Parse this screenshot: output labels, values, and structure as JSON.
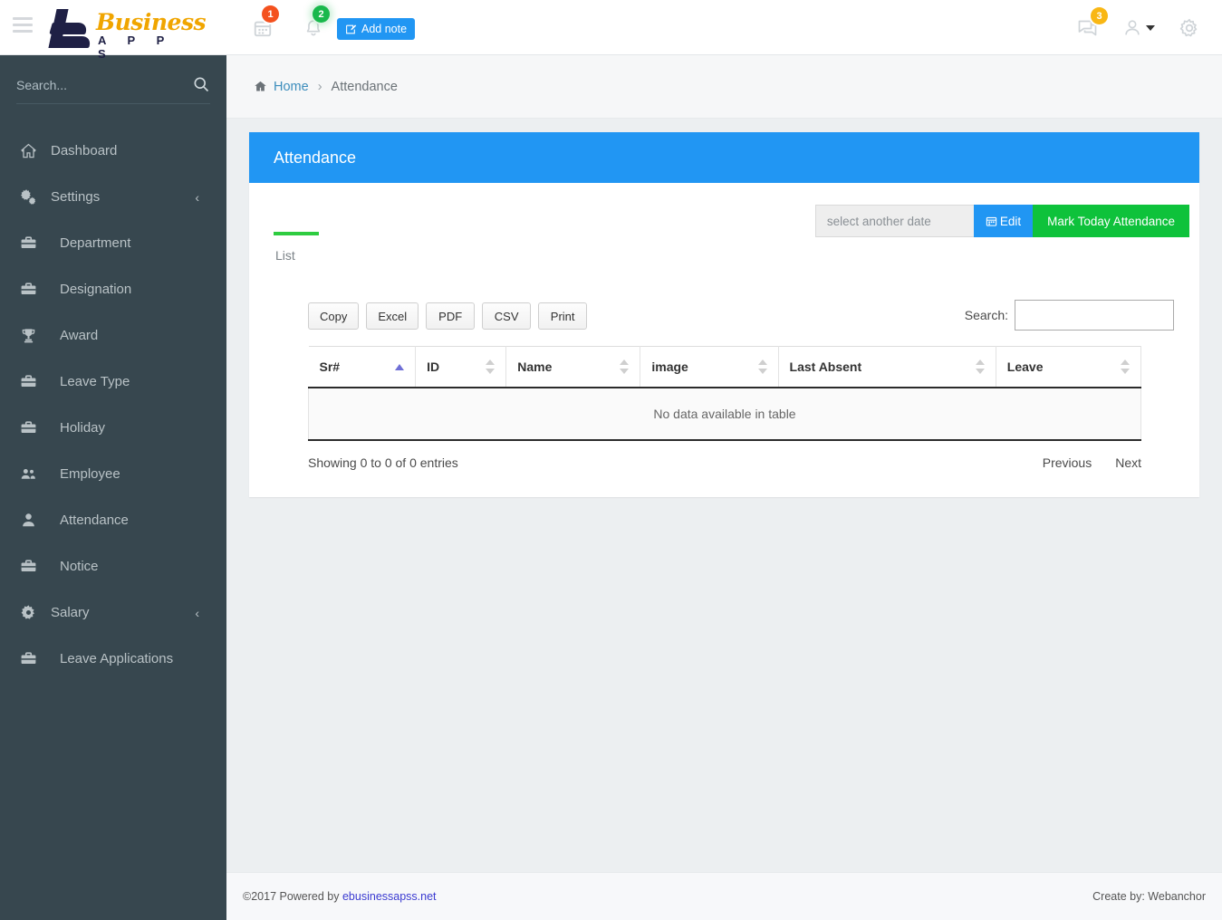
{
  "topbar": {
    "menu_toggle": "menu",
    "logo_business": "Business",
    "logo_apps": "A P P S",
    "calendar_badge": "1",
    "bell_badge": "2",
    "add_note_label": "Add note",
    "chat_badge": "3"
  },
  "sidebar": {
    "search_placeholder": "Search...",
    "items": [
      {
        "label": "Dashboard",
        "icon": "home-icon",
        "sub": false,
        "chevron": ""
      },
      {
        "label": "Settings",
        "icon": "gears-icon",
        "sub": false,
        "chevron": "‹"
      },
      {
        "label": "Department",
        "icon": "briefcase-icon",
        "sub": true,
        "chevron": ""
      },
      {
        "label": "Designation",
        "icon": "briefcase-icon",
        "sub": true,
        "chevron": ""
      },
      {
        "label": "Award",
        "icon": "trophy-icon",
        "sub": true,
        "chevron": ""
      },
      {
        "label": "Leave Type",
        "icon": "briefcase-icon",
        "sub": true,
        "chevron": ""
      },
      {
        "label": "Holiday",
        "icon": "briefcase-icon",
        "sub": true,
        "chevron": ""
      },
      {
        "label": "Employee",
        "icon": "users-icon",
        "sub": true,
        "chevron": ""
      },
      {
        "label": "Attendance",
        "icon": "user-icon",
        "sub": true,
        "chevron": ""
      },
      {
        "label": "Notice",
        "icon": "briefcase-icon",
        "sub": true,
        "chevron": ""
      },
      {
        "label": "Salary",
        "icon": "gear-icon",
        "sub": false,
        "chevron": "‹"
      },
      {
        "label": "Leave Applications",
        "icon": "briefcase-icon",
        "sub": true,
        "chevron": ""
      }
    ]
  },
  "breadcrumb": {
    "home": "Home",
    "separator": "›",
    "current": "Attendance"
  },
  "panel": {
    "title": "Attendance",
    "date_placeholder": "select another date",
    "date_value": "",
    "edit_label": "Edit",
    "mark_label": "Mark Today Attendance",
    "tab_list": "List"
  },
  "datatable": {
    "export_buttons": [
      "Copy",
      "Excel",
      "PDF",
      "CSV",
      "Print"
    ],
    "search_label": "Search:",
    "search_value": "",
    "columns": [
      {
        "label": "Sr#",
        "sort": "asc"
      },
      {
        "label": "ID",
        "sort": "none"
      },
      {
        "label": "Name",
        "sort": "none"
      },
      {
        "label": "image",
        "sort": "none"
      },
      {
        "label": "Last Absent",
        "sort": "none"
      },
      {
        "label": "Leave",
        "sort": "none"
      }
    ],
    "rows": [],
    "empty_message": "No data available in table",
    "info": "Showing 0 to 0 of 0 entries",
    "previous_label": "Previous",
    "next_label": "Next"
  },
  "footer": {
    "copyright_prefix": "©2017 Powered by ",
    "link": "ebusinessapss.net",
    "credit": "Create by: Webanchor"
  },
  "colors": {
    "accent_blue": "#2196f3",
    "accent_green": "#0ec23b",
    "sidebar": "#37474f",
    "page_bg": "#eceff1",
    "logo_gold": "#f0a500",
    "logo_navy": "#1f2045"
  }
}
